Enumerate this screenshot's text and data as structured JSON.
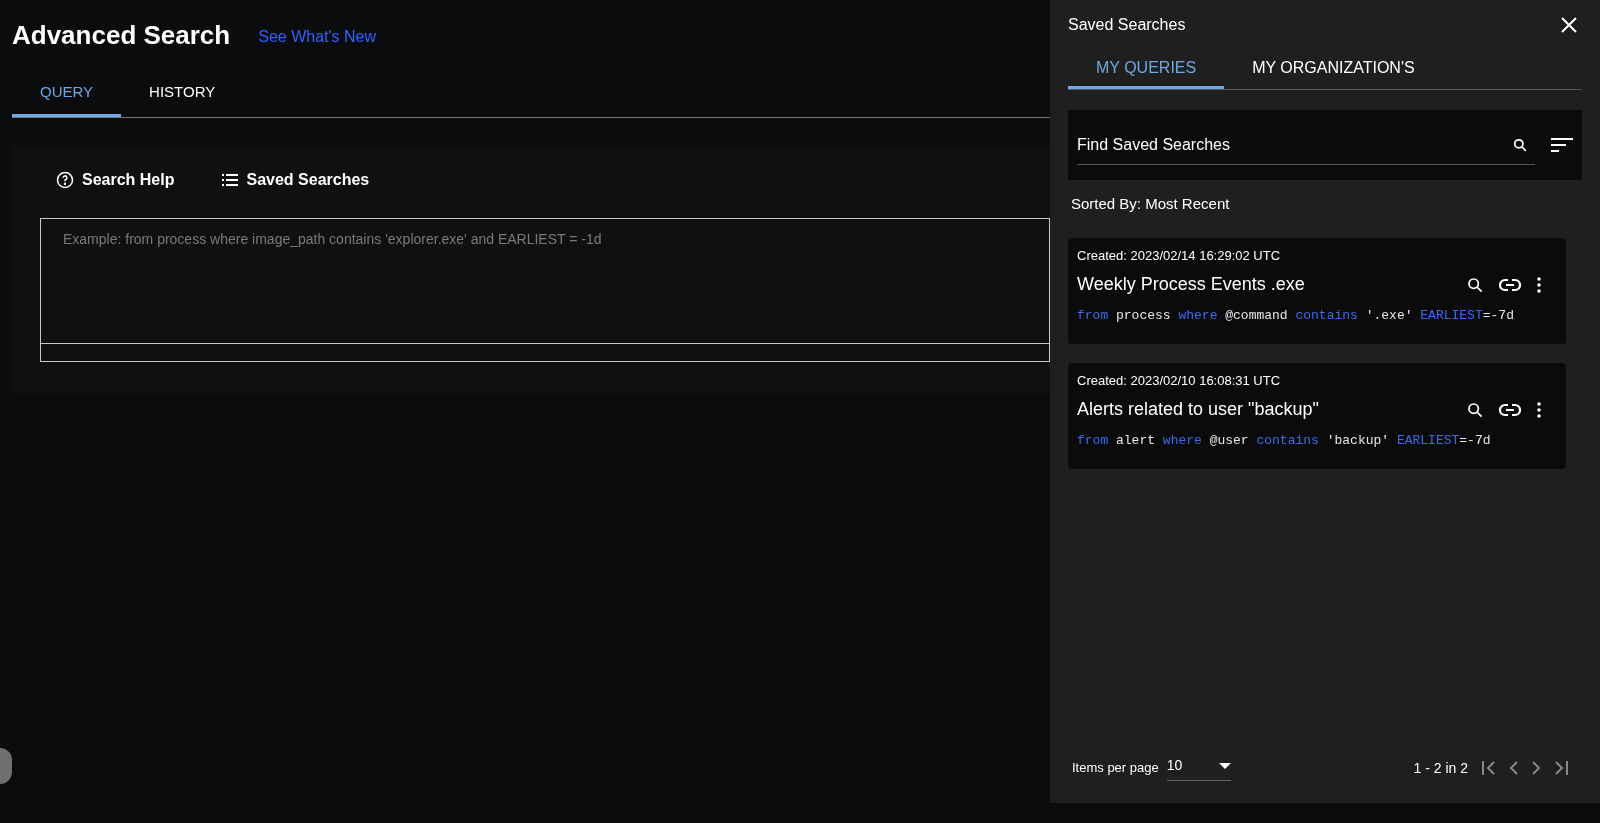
{
  "page": {
    "title": "Advanced Search",
    "whats_new_link": "See What's New"
  },
  "tabs": [
    {
      "label": "QUERY",
      "selected": true
    },
    {
      "label": "HISTORY",
      "selected": false
    }
  ],
  "toolbar": {
    "search_help": "Search Help",
    "saved_searches": "Saved Searches"
  },
  "query_editor": {
    "placeholder": "Example: from process where image_path contains 'explorer.exe' and EARLIEST = -1d"
  },
  "saved_panel": {
    "title": "Saved Searches",
    "tabs": [
      {
        "label": "MY QUERIES",
        "selected": true
      },
      {
        "label": "MY ORGANIZATION'S",
        "selected": false
      }
    ],
    "search": {
      "placeholder": "Find Saved Searches"
    },
    "sorted_by": "Sorted By: Most Recent",
    "items": [
      {
        "created": "Created: 2023/02/14 16:29:02 UTC",
        "name": "Weekly Process Events .exe",
        "query": [
          {
            "text": "from",
            "kind": "keyword"
          },
          {
            "text": " process ",
            "kind": "plain"
          },
          {
            "text": "where",
            "kind": "keyword"
          },
          {
            "text": " @command ",
            "kind": "plain"
          },
          {
            "text": "contains",
            "kind": "keyword"
          },
          {
            "text": " '.exe' ",
            "kind": "plain"
          },
          {
            "text": "EARLIEST",
            "kind": "keyword"
          },
          {
            "text": "=-7d",
            "kind": "plain"
          }
        ]
      },
      {
        "created": "Created: 2023/02/10 16:08:31 UTC",
        "name": "Alerts related to user \"backup\"",
        "query": [
          {
            "text": "from",
            "kind": "keyword"
          },
          {
            "text": " alert ",
            "kind": "plain"
          },
          {
            "text": "where",
            "kind": "keyword"
          },
          {
            "text": " @user ",
            "kind": "plain"
          },
          {
            "text": "contains",
            "kind": "keyword"
          },
          {
            "text": " 'backup' ",
            "kind": "plain"
          },
          {
            "text": "EARLIEST",
            "kind": "keyword"
          },
          {
            "text": "=-7d",
            "kind": "plain"
          }
        ]
      }
    ],
    "pagination": {
      "items_per_page_label": "Items per page",
      "items_per_page": "10",
      "range": "1 - 2 in 2"
    }
  }
}
